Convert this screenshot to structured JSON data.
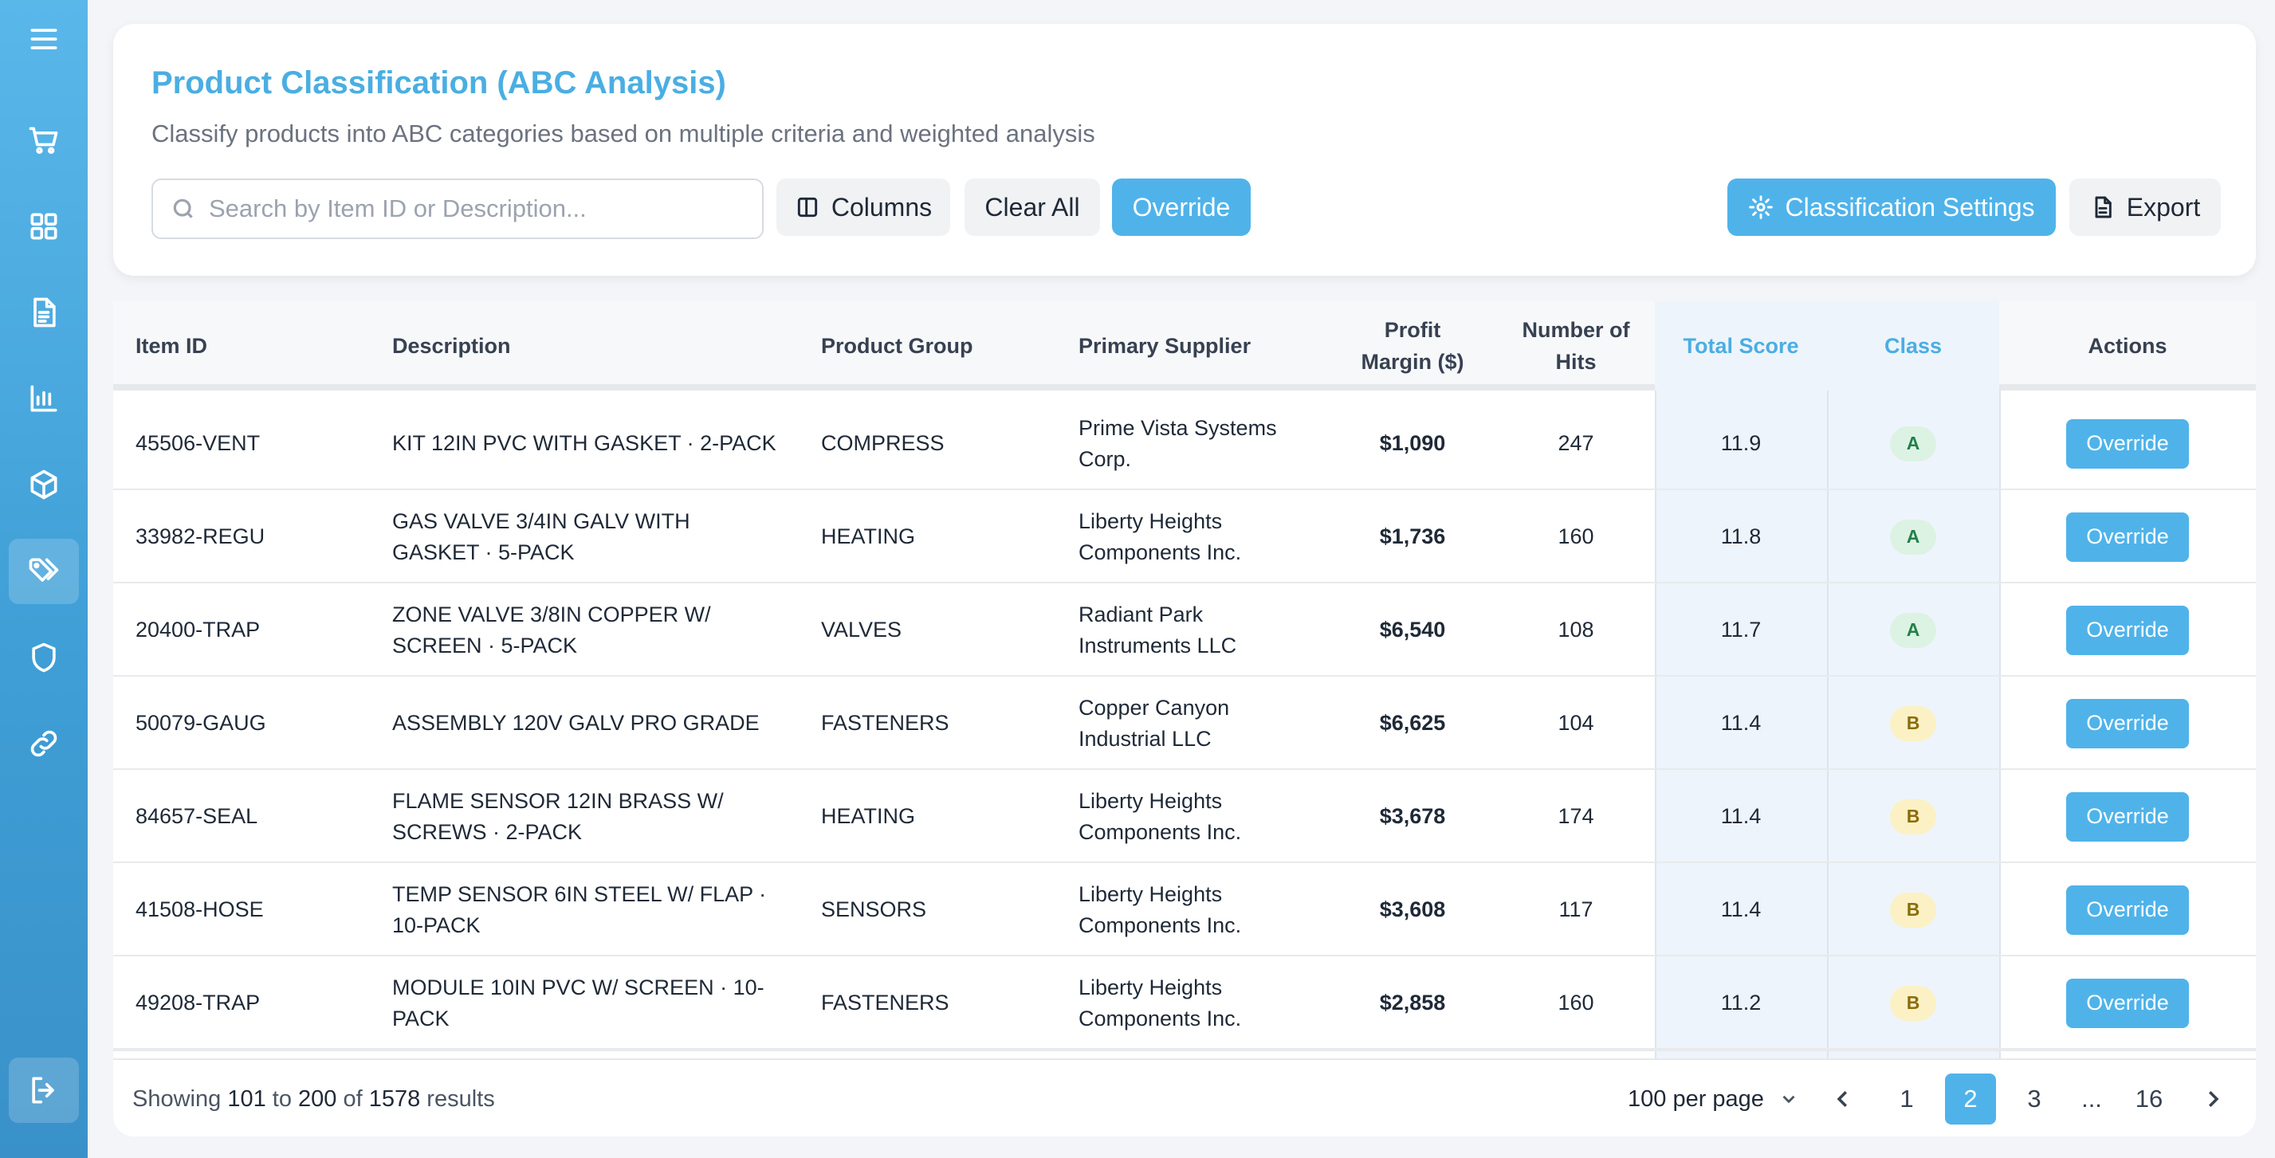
{
  "sidebar": {
    "items": [
      {
        "icon": "menu-icon"
      },
      {
        "icon": "cart-icon"
      },
      {
        "icon": "grid-icon"
      },
      {
        "icon": "document-icon"
      },
      {
        "icon": "bar-chart-icon"
      },
      {
        "icon": "box-icon"
      },
      {
        "icon": "tags-icon"
      },
      {
        "icon": "shield-icon"
      },
      {
        "icon": "link-icon"
      },
      {
        "icon": "logout-icon"
      }
    ]
  },
  "header": {
    "title": "Product Classification (ABC Analysis)",
    "subtitle": "Classify products into ABC categories based on multiple criteria and weighted analysis",
    "search_placeholder": "Search by Item ID or Description...",
    "columns_label": "Columns",
    "clear_label": "Clear All",
    "override_label": "Override",
    "settings_label": "Classification Settings",
    "export_label": "Export"
  },
  "table": {
    "headers": {
      "item_id": "Item ID",
      "description": "Description",
      "group": "Product Group",
      "supplier": "Primary Supplier",
      "margin": "Profit Margin ($)",
      "hits": "Number of Hits",
      "score": "Total Score",
      "class": "Class",
      "actions": "Actions"
    },
    "rows": [
      {
        "item_id": "45506-VENT",
        "description": "KIT 12IN PVC WITH GASKET · 2-PACK",
        "group": "COMPRESS",
        "supplier": "Prime Vista Systems Corp.",
        "margin": "$1,090",
        "hits": "247",
        "score": "11.9",
        "class": "A",
        "action": "Override"
      },
      {
        "item_id": "33982-REGU",
        "description": "GAS VALVE 3/4IN GALV WITH GASKET · 5-PACK",
        "group": "HEATING",
        "supplier": "Liberty Heights Components Inc.",
        "margin": "$1,736",
        "hits": "160",
        "score": "11.8",
        "class": "A",
        "action": "Override"
      },
      {
        "item_id": "20400-TRAP",
        "description": "ZONE VALVE 3/8IN COPPER W/ SCREEN · 5-PACK",
        "group": "VALVES",
        "supplier": "Radiant Park Instruments LLC",
        "margin": "$6,540",
        "hits": "108",
        "score": "11.7",
        "class": "A",
        "action": "Override"
      },
      {
        "item_id": "50079-GAUG",
        "description": "ASSEMBLY 120V GALV PRO GRADE",
        "group": "FASTENERS",
        "supplier": "Copper Canyon Industrial LLC",
        "margin": "$6,625",
        "hits": "104",
        "score": "11.4",
        "class": "B",
        "action": "Override"
      },
      {
        "item_id": "84657-SEAL",
        "description": "FLAME SENSOR 12IN BRASS W/ SCREWS · 2-PACK",
        "group": "HEATING",
        "supplier": "Liberty Heights Components Inc.",
        "margin": "$3,678",
        "hits": "174",
        "score": "11.4",
        "class": "B",
        "action": "Override"
      },
      {
        "item_id": "41508-HOSE",
        "description": "TEMP SENSOR 6IN STEEL W/ FLAP · 10-PACK",
        "group": "SENSORS",
        "supplier": "Liberty Heights Components Inc.",
        "margin": "$3,608",
        "hits": "117",
        "score": "11.4",
        "class": "B",
        "action": "Override"
      },
      {
        "item_id": "49208-TRAP",
        "description": "MODULE 10IN PVC W/ SCREEN · 10-PACK",
        "group": "FASTENERS",
        "supplier": "Liberty Heights Components Inc.",
        "margin": "$2,858",
        "hits": "160",
        "score": "11.2",
        "class": "B",
        "action": "Override"
      }
    ]
  },
  "footer": {
    "showing_prefix": "Showing",
    "from": "101",
    "to_word": "to",
    "to": "200",
    "of_word": "of",
    "total": "1578",
    "results_word": "results",
    "per_page": "100 per page",
    "pages": [
      "1",
      "2",
      "3",
      "...",
      "16"
    ],
    "current_page": "2"
  },
  "colors": {
    "accent": "#4fb3ea",
    "title": "#4aaee2",
    "class_a_bg": "#dcf3e4",
    "class_b_bg": "#fbf1c4"
  }
}
